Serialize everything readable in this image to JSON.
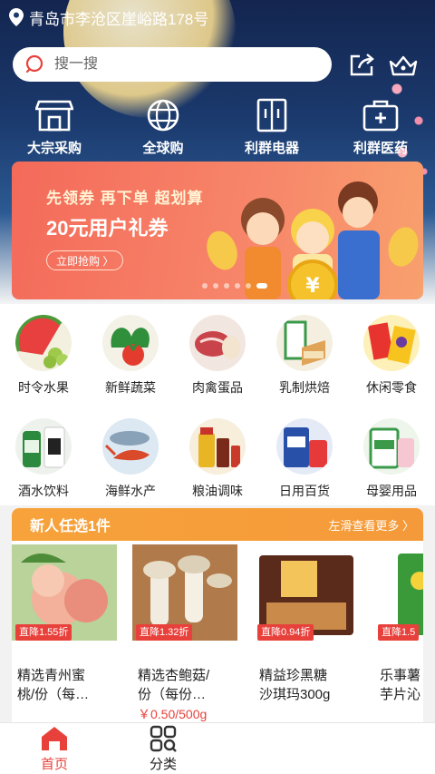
{
  "location": {
    "address": "青岛市李沧区崖峪路178号",
    "icon": "location-pin-icon"
  },
  "search": {
    "placeholder": "搜一搜",
    "icon": "search-icon"
  },
  "header_icons": [
    "share-icon",
    "crown-basket-icon"
  ],
  "quick_nav": [
    {
      "label": "大宗采购",
      "icon": "store-icon"
    },
    {
      "label": "全球购",
      "icon": "globe-icon"
    },
    {
      "label": "利群电器",
      "icon": "refrigerator-icon"
    },
    {
      "label": "利群医药",
      "icon": "medical-kit-icon"
    }
  ],
  "banner": {
    "line1": "先领券 再下单 超划算",
    "line2": "20元用户礼券",
    "button": "立即抢购 〉",
    "slide_count": 6,
    "active_slide": 5
  },
  "categories": [
    {
      "label": "时令水果"
    },
    {
      "label": "新鲜蔬菜"
    },
    {
      "label": "肉禽蛋品"
    },
    {
      "label": "乳制烘焙"
    },
    {
      "label": "休闲零食"
    },
    {
      "label": "酒水饮料"
    },
    {
      "label": "海鲜水产"
    },
    {
      "label": "粮油调味"
    },
    {
      "label": "日用百货"
    },
    {
      "label": "母婴用品"
    }
  ],
  "new_user": {
    "title": "新人任选1件",
    "more": "左滑查看更多 〉",
    "products": [
      {
        "tag": "直降1.55折",
        "name": "精选青州蜜\n桃/份（每…",
        "price": ""
      },
      {
        "tag": "直降1.32折",
        "name": "精选杏鲍菇/\n份（每份…",
        "price": "￥0.50/500g"
      },
      {
        "tag": "直降0.94折",
        "name": "精益珍黑糖\n沙琪玛300g",
        "price": ""
      },
      {
        "tag": "直降1.5",
        "name": "乐事薯\n芋片沁",
        "price": ""
      }
    ]
  },
  "bottom_nav": [
    {
      "label": "首页",
      "icon": "home-icon",
      "active": true
    },
    {
      "label": "分类",
      "icon": "category-grid-icon",
      "active": false
    }
  ],
  "colors": {
    "accent": "#e8413b",
    "section_orange": "#f7a23b",
    "hero_navy": "#13254f"
  }
}
